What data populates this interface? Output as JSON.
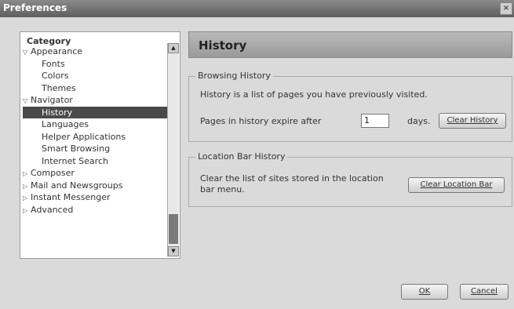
{
  "window": {
    "title": "Preferences",
    "close_label": "×"
  },
  "category": {
    "header": "Category",
    "items": [
      {
        "label": "Appearance",
        "twisty": "▽",
        "level": 0
      },
      {
        "label": "Fonts",
        "level": 1
      },
      {
        "label": "Colors",
        "level": 1
      },
      {
        "label": "Themes",
        "level": 1
      },
      {
        "label": "Navigator",
        "twisty": "▽",
        "level": 0
      },
      {
        "label": "History",
        "level": 1,
        "selected": true
      },
      {
        "label": "Languages",
        "level": 1
      },
      {
        "label": "Helper Applications",
        "level": 1
      },
      {
        "label": "Smart Browsing",
        "level": 1
      },
      {
        "label": "Internet Search",
        "level": 1
      },
      {
        "label": "Composer",
        "twisty": "▷",
        "level": 0
      },
      {
        "label": "Mail and Newsgroups",
        "twisty": "▷",
        "level": 0
      },
      {
        "label": "Instant Messenger",
        "twisty": "▷",
        "level": 0
      },
      {
        "label": "Advanced",
        "twisty": "▷",
        "level": 0
      }
    ]
  },
  "panel": {
    "title": "History",
    "browsing": {
      "legend": "Browsing History",
      "description": "History is a list of pages you have previously visited.",
      "expire_label": "Pages in history expire after",
      "days_value": "1",
      "days_label": "days.",
      "clear_button": "Clear History"
    },
    "location": {
      "legend": "Location Bar History",
      "description": "Clear the list of sites stored in the location bar menu.",
      "clear_button": "Clear Location Bar"
    }
  },
  "footer": {
    "ok": "OK",
    "cancel": "Cancel"
  }
}
